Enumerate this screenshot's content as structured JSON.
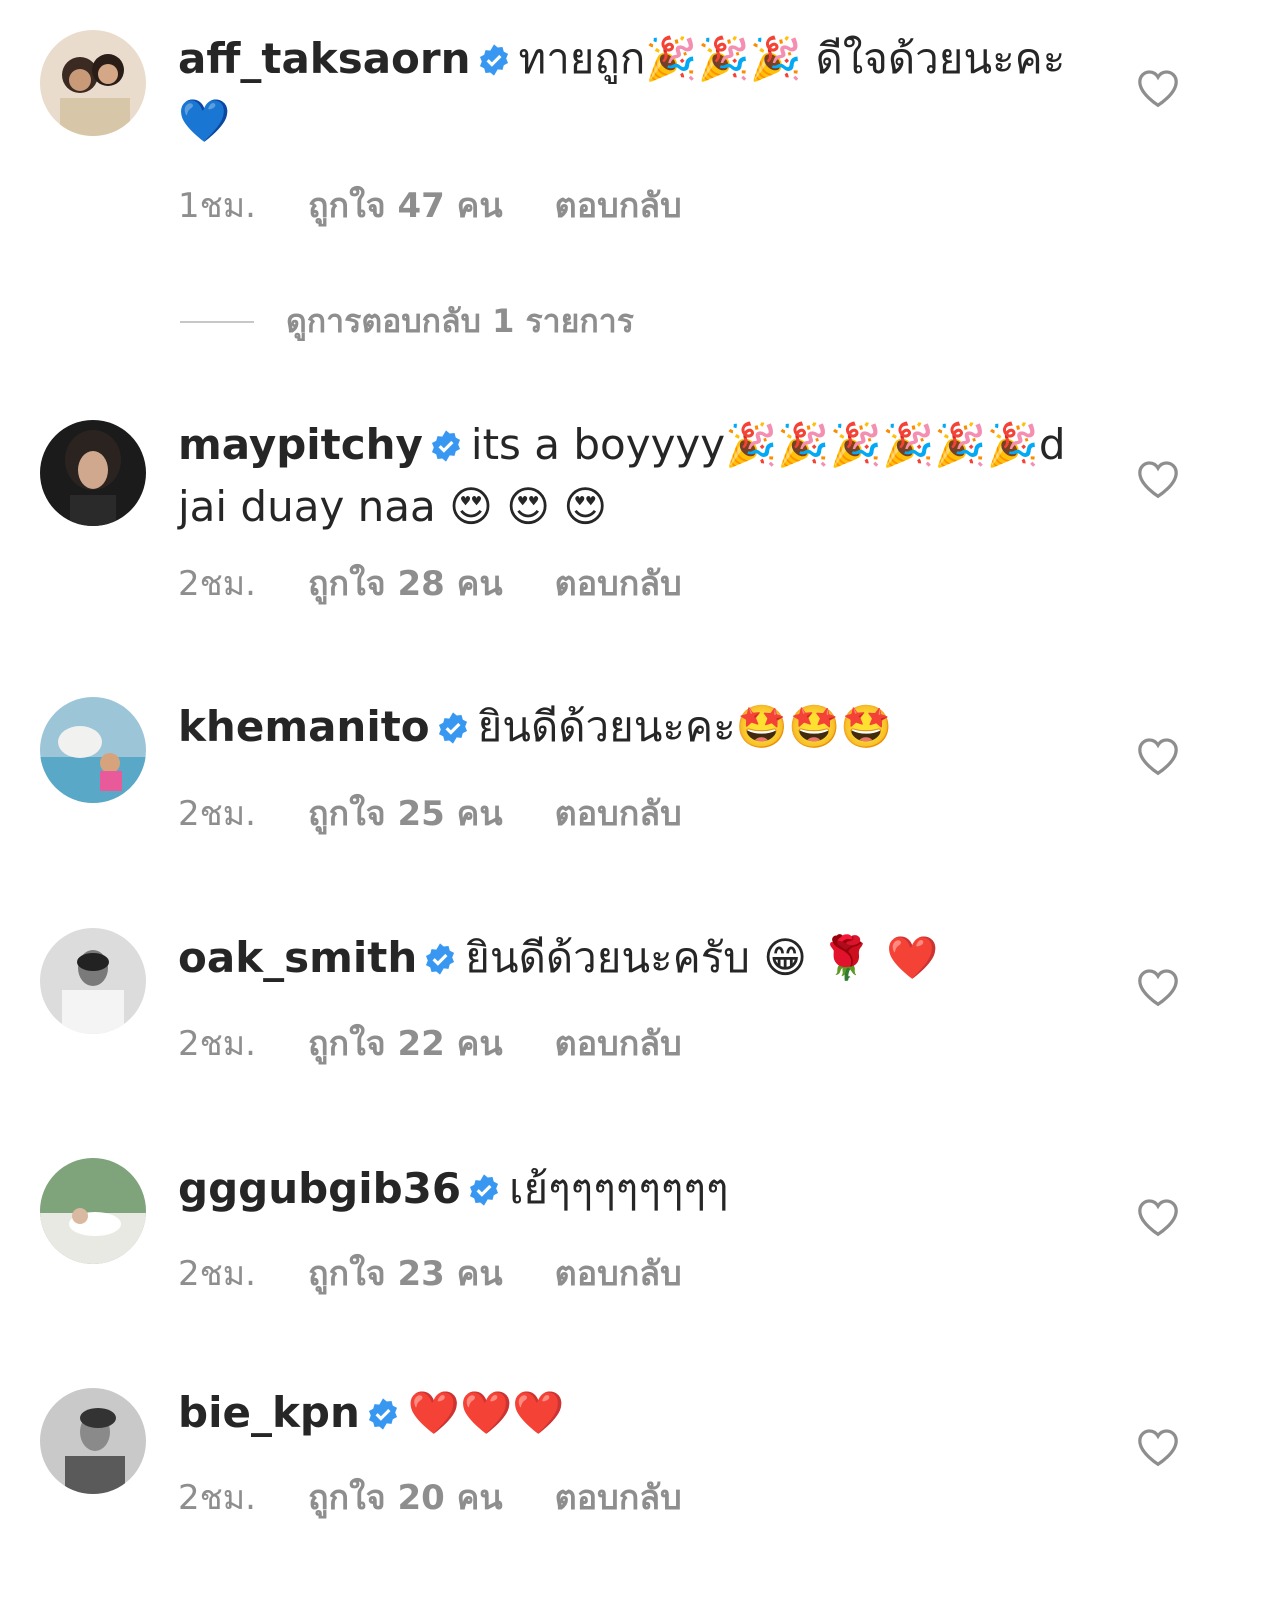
{
  "comments": [
    {
      "username": "aff_taksaorn",
      "text": "ทายถูก🎉🎉🎉 ดีใจด้วยนะคะ 💙",
      "time": "1ชม.",
      "likes": "ถูกใจ 47 คน",
      "reply": "ตอบกลับ"
    },
    {
      "username": "maypitchy",
      "text": "its a boyyyy🎉🎉🎉🎉🎉🎉d jai duay naa 😍 😍 😍",
      "time": "2ชม.",
      "likes": "ถูกใจ 28 คน",
      "reply": "ตอบกลับ"
    },
    {
      "username": "khemanito",
      "text": "ยินดีด้วยนะคะ🤩🤩🤩",
      "time": "2ชม.",
      "likes": "ถูกใจ 25 คน",
      "reply": "ตอบกลับ"
    },
    {
      "username": "oak_smith",
      "text": "ยินดีด้วยนะครับ 😁 🌹 ❤️",
      "time": "2ชม.",
      "likes": "ถูกใจ 22 คน",
      "reply": "ตอบกลับ"
    },
    {
      "username": "gggubgib36",
      "text": "เย้ๆๆๆๆๆๆๆๆ",
      "time": "2ชม.",
      "likes": "ถูกใจ 23 คน",
      "reply": "ตอบกลับ"
    },
    {
      "username": "bie_kpn",
      "text": "❤️❤️❤️",
      "time": "2ชม.",
      "likes": "ถูกใจ 20 คน",
      "reply": "ตอบกลับ"
    }
  ],
  "view_replies": "ดูการตอบกลับ 1 รายการ",
  "icons": {
    "verified": "verified-badge-icon",
    "like": "heart-outline-icon"
  },
  "colors": {
    "text": "#262626",
    "secondary": "#8e8e8e",
    "verified": "#3897f0"
  }
}
